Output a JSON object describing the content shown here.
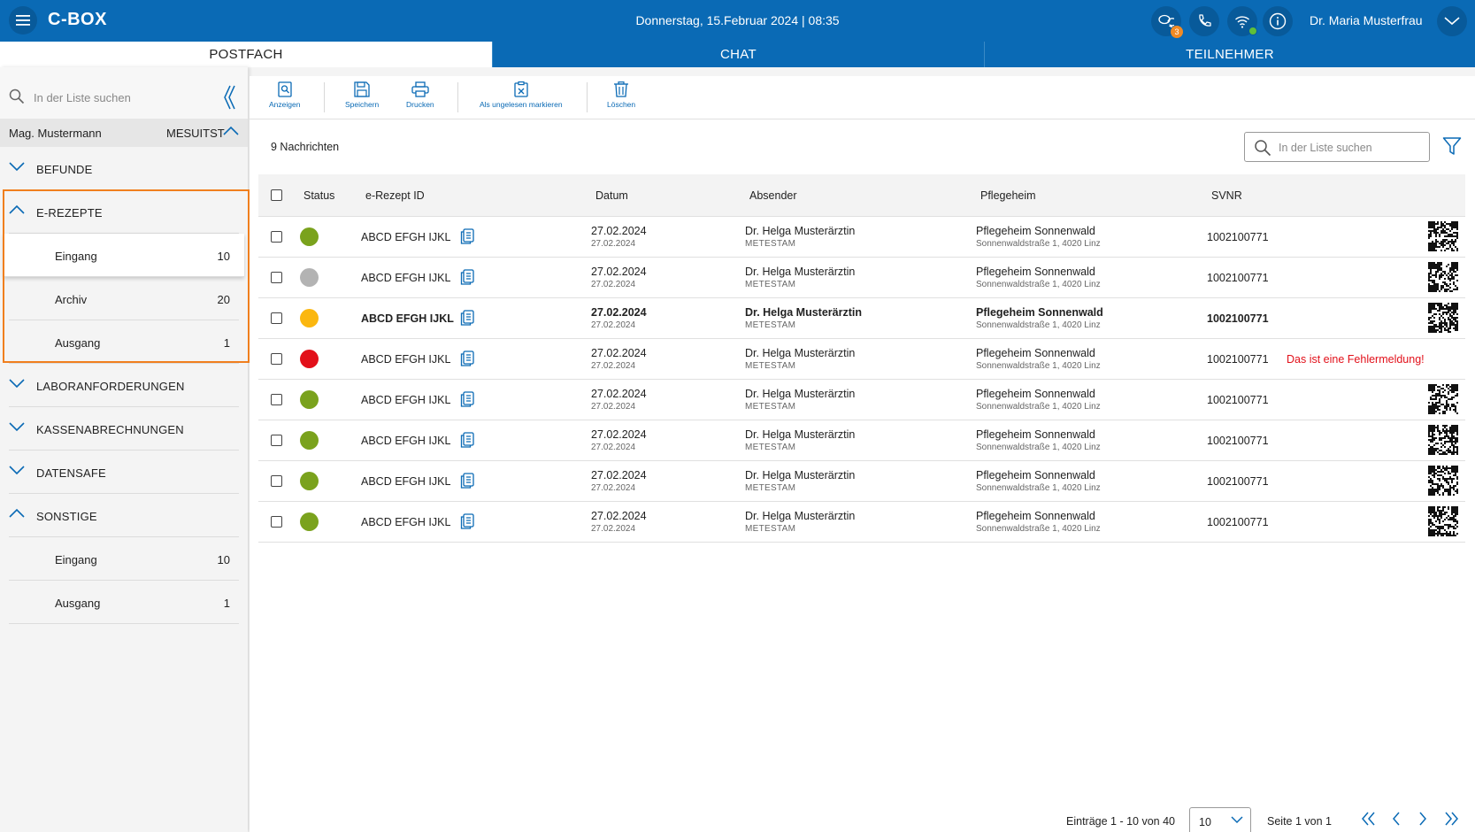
{
  "header": {
    "app_title": "C-BOX",
    "datetime": "Donnerstag, 15.Februar 2024 | 08:35",
    "chat_badge": "3",
    "user_name": "Dr. Maria Musterfrau"
  },
  "tabs": [
    {
      "label": "POSTFACH",
      "active": true
    },
    {
      "label": "CHAT",
      "active": false
    },
    {
      "label": "TEILNEHMER",
      "active": false
    }
  ],
  "sidebar": {
    "search_placeholder": "In der Liste suchen",
    "user_name": "Mag. Mustermann",
    "user_code": "MESUITST",
    "categories": {
      "befunde": {
        "label": "BEFUNDE",
        "expanded": false
      },
      "erezepte": {
        "label": "E-REZEPTE",
        "expanded": true,
        "items": [
          {
            "label": "Eingang",
            "count": "10",
            "selected": true
          },
          {
            "label": "Archiv",
            "count": "20"
          },
          {
            "label": "Ausgang",
            "count": "1"
          }
        ]
      },
      "labor": {
        "label": "LABORANFORDERUNGEN",
        "expanded": false
      },
      "kassen": {
        "label": "KASSENABRECHNUNGEN",
        "expanded": false
      },
      "datensafe": {
        "label": "DATENSAFE",
        "expanded": false
      },
      "sonstige": {
        "label": "SONSTIGE",
        "expanded": true,
        "items": [
          {
            "label": "Eingang",
            "count": "10"
          },
          {
            "label": "Ausgang",
            "count": "1"
          }
        ]
      }
    }
  },
  "toolbar": {
    "anzeigen": "Anzeigen",
    "speichern": "Speichern",
    "drucken": "Drucken",
    "ungelesen": "Als ungelesen markieren",
    "loeschen": "Löschen"
  },
  "list": {
    "count_label": "9 Nachrichten",
    "search_placeholder": "In der Liste suchen"
  },
  "table": {
    "columns": {
      "status": "Status",
      "id": "e-Rezept ID",
      "datum": "Datum",
      "absender": "Absender",
      "pflegeheim": "Pflegeheim",
      "svnr": "SVNR"
    },
    "status_colors": {
      "ok": "#7aa21d",
      "grey": "#b3b3b3",
      "pending": "#fbb70f",
      "error": "#e2101a"
    },
    "rows": [
      {
        "status": "ok",
        "id": "ABCD EFGH IJKL",
        "date": "27.02.2024",
        "date2": "27.02.2024",
        "sender": "Dr. Helga Musterärztin",
        "sender_code": "METESTAM",
        "home": "Pflegeheim Sonnenwald",
        "address": "Sonnenwaldstraße 1, 4020 Linz",
        "svnr": "1002100771",
        "error": ""
      },
      {
        "status": "grey",
        "id": "ABCD EFGH IJKL",
        "date": "27.02.2024",
        "date2": "27.02.2024",
        "sender": "Dr. Helga Musterärztin",
        "sender_code": "METESTAM",
        "home": "Pflegeheim Sonnenwald",
        "address": "Sonnenwaldstraße 1, 4020 Linz",
        "svnr": "1002100771",
        "error": ""
      },
      {
        "status": "pending",
        "id": "ABCD EFGH IJKL",
        "date": "27.02.2024",
        "date2": "27.02.2024",
        "sender": "Dr. Helga Musterärztin",
        "sender_code": "METESTAM",
        "home": "Pflegeheim Sonnenwald",
        "address": "Sonnenwaldstraße 1, 4020 Linz",
        "svnr": "1002100771",
        "error": "",
        "unread": true
      },
      {
        "status": "error",
        "id": "ABCD EFGH IJKL",
        "date": "27.02.2024",
        "date2": "27.02.2024",
        "sender": "Dr. Helga Musterärztin",
        "sender_code": "METESTAM",
        "home": "Pflegeheim Sonnenwald",
        "address": "Sonnenwaldstraße 1, 4020 Linz",
        "svnr": "1002100771",
        "error": "Das ist eine Fehlermeldung!"
      },
      {
        "status": "ok",
        "id": "ABCD EFGH IJKL",
        "date": "27.02.2024",
        "date2": "27.02.2024",
        "sender": "Dr. Helga Musterärztin",
        "sender_code": "METESTAM",
        "home": "Pflegeheim Sonnenwald",
        "address": "Sonnenwaldstraße 1, 4020 Linz",
        "svnr": "1002100771",
        "error": ""
      },
      {
        "status": "ok",
        "id": "ABCD EFGH IJKL",
        "date": "27.02.2024",
        "date2": "27.02.2024",
        "sender": "Dr. Helga Musterärztin",
        "sender_code": "METESTAM",
        "home": "Pflegeheim Sonnenwald",
        "address": "Sonnenwaldstraße 1, 4020 Linz",
        "svnr": "1002100771",
        "error": ""
      },
      {
        "status": "ok",
        "id": "ABCD EFGH IJKL",
        "date": "27.02.2024",
        "date2": "27.02.2024",
        "sender": "Dr. Helga Musterärztin",
        "sender_code": "METESTAM",
        "home": "Pflegeheim Sonnenwald",
        "address": "Sonnenwaldstraße 1, 4020 Linz",
        "svnr": "1002100771",
        "error": ""
      },
      {
        "status": "ok",
        "id": "ABCD EFGH IJKL",
        "date": "27.02.2024",
        "date2": "27.02.2024",
        "sender": "Dr. Helga Musterärztin",
        "sender_code": "METESTAM",
        "home": "Pflegeheim Sonnenwald",
        "address": "Sonnenwaldstraße 1, 4020 Linz",
        "svnr": "1002100771",
        "error": ""
      }
    ]
  },
  "pagination": {
    "entries": "Einträge 1 - 10 von 40",
    "per_page": "10",
    "page_label": "Seite 1 von 1"
  },
  "colors": {
    "brand": "#0a6ab5",
    "highlight": "#f07f1e",
    "error": "#e2101a"
  }
}
